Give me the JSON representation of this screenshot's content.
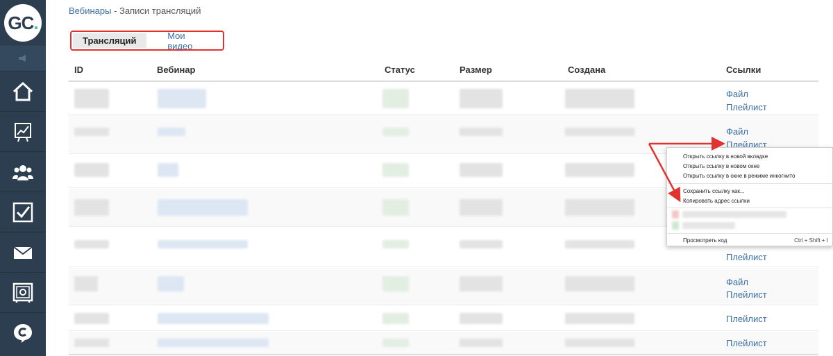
{
  "logo": {
    "text": "GC",
    "dot": "."
  },
  "breadcrumb": {
    "parent": "Вебинары",
    "separator": " - ",
    "current": "Записи трансляций"
  },
  "tabs": [
    {
      "label": "Трансляций",
      "active": true
    },
    {
      "label": "Мои видео",
      "active": false
    }
  ],
  "table": {
    "headers": [
      "ID",
      "Вебинар",
      "Статус",
      "Размер",
      "Создана",
      "Ссылки"
    ],
    "rows": [
      {
        "links": [
          "Файл",
          "Плейлист"
        ]
      },
      {
        "links": [
          "Файл",
          "Плейлист"
        ]
      },
      {
        "links": []
      },
      {
        "links": []
      },
      {
        "links": [
          "Плейлист"
        ]
      },
      {
        "links": [
          "Файл",
          "Плейлист"
        ]
      },
      {
        "links": [
          "Плейлист"
        ]
      },
      {
        "links": [
          "Плейлист"
        ]
      }
    ]
  },
  "context_menu": {
    "items": [
      "Открыть ссылку в новой вкладке",
      "Открыть ссылку в новом окне",
      "Открыть ссылку в окне в режиме инкогнито",
      "Сохранить ссылку как...",
      "Копировать адрес ссылки",
      "Просмотреть код"
    ],
    "shortcut": "Ctrl + Shift + I"
  },
  "colors": {
    "sidebar": "#2d3e50",
    "link": "#3a6ea5",
    "highlight": "#e0332f"
  },
  "icons": [
    "home-icon",
    "chart-icon",
    "users-icon",
    "checkbox-icon",
    "mail-icon",
    "safe-icon",
    "chat-icon",
    "megaphone-icon"
  ]
}
